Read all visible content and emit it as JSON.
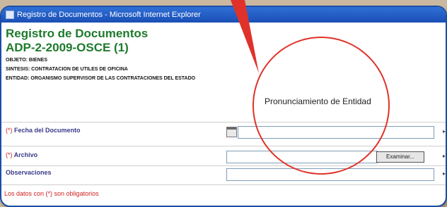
{
  "window": {
    "title": "Registro de Documentos - Microsoft Internet Explorer"
  },
  "document": {
    "heading": "Registro de Documentos",
    "code": "ADP-2-2009-OSCE (1)",
    "objeto": "OBJETO: BIENES",
    "sintesis": "SINTESIS: CONTRATACION DE UTILES DE OFICINA",
    "entidad": "ENTIDAD: ORGANISMO SUPERVISOR DE LAS CONTRATACIONES DEL ESTADO"
  },
  "section": {
    "title": "Pronunciamiento de Entidad"
  },
  "form": {
    "required_marker": "(*)",
    "fecha_label": "Fecha del Documento",
    "archivo_label": "Archivo",
    "browse_label": "Examinar...",
    "observaciones_label": "Observaciones",
    "fecha_value": "",
    "archivo_value": "",
    "observaciones_value": "",
    "footnote": "Los datos con (*) son obligatorios"
  },
  "annotation": {
    "color": "#e0322a"
  },
  "colors": {
    "title_bar": "#1b4fb5",
    "heading": "#1d7a2c",
    "required": "#cc1f1f",
    "label": "#3a3a8a"
  }
}
